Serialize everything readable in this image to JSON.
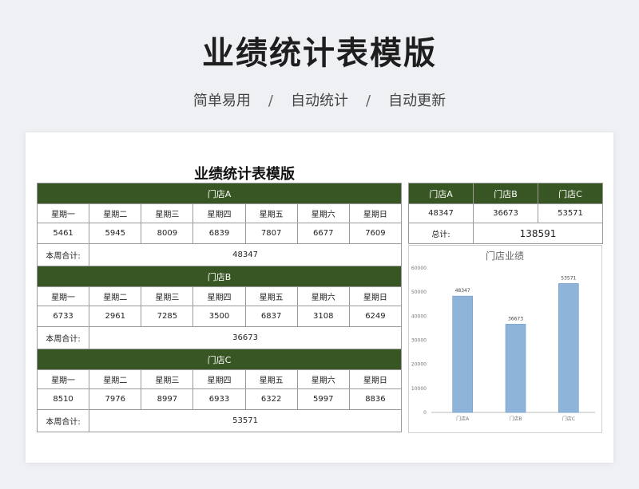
{
  "hero": {
    "title": "业绩统计表模版",
    "tags": [
      "简单易用",
      "自动统计",
      "自动更新"
    ],
    "separator": "/"
  },
  "sheet": {
    "title": "业绩统计表模版",
    "days": [
      "星期一",
      "星期二",
      "星期三",
      "星期四",
      "星期五",
      "星期六",
      "星期日"
    ],
    "total_label": "本周合计:",
    "stores": [
      {
        "name": "门店A",
        "values": [
          "5461",
          "5945",
          "8009",
          "6839",
          "7807",
          "6677",
          "7609"
        ],
        "total": "48347"
      },
      {
        "name": "门店B",
        "values": [
          "6733",
          "2961",
          "7285",
          "3500",
          "6837",
          "3108",
          "6249"
        ],
        "total": "36673"
      },
      {
        "name": "门店C",
        "values": [
          "8510",
          "7976",
          "8997",
          "6933",
          "6322",
          "5997",
          "8836"
        ],
        "total": "53571"
      }
    ]
  },
  "summary": {
    "headers": [
      "门店A",
      "门店B",
      "门店C"
    ],
    "values": [
      "48347",
      "36673",
      "53571"
    ],
    "total_label": "总计:",
    "grand_total": "138591"
  },
  "colors": {
    "header_green": "#375623",
    "bar_blue": "#8fb4d9"
  },
  "chart_data": {
    "type": "bar",
    "title": "门店业绩",
    "categories": [
      "门店A",
      "门店B",
      "门店C"
    ],
    "values": [
      48347,
      36673,
      53571
    ],
    "data_labels": [
      "48347",
      "36673",
      "53571"
    ],
    "ylim": [
      0,
      60000
    ],
    "yticks": [
      0,
      10000,
      20000,
      30000,
      40000,
      50000,
      60000
    ],
    "ytick_labels": [
      "0",
      "10000",
      "20000",
      "30000",
      "40000",
      "50000",
      "60000"
    ],
    "grid": false,
    "legend": "none"
  }
}
